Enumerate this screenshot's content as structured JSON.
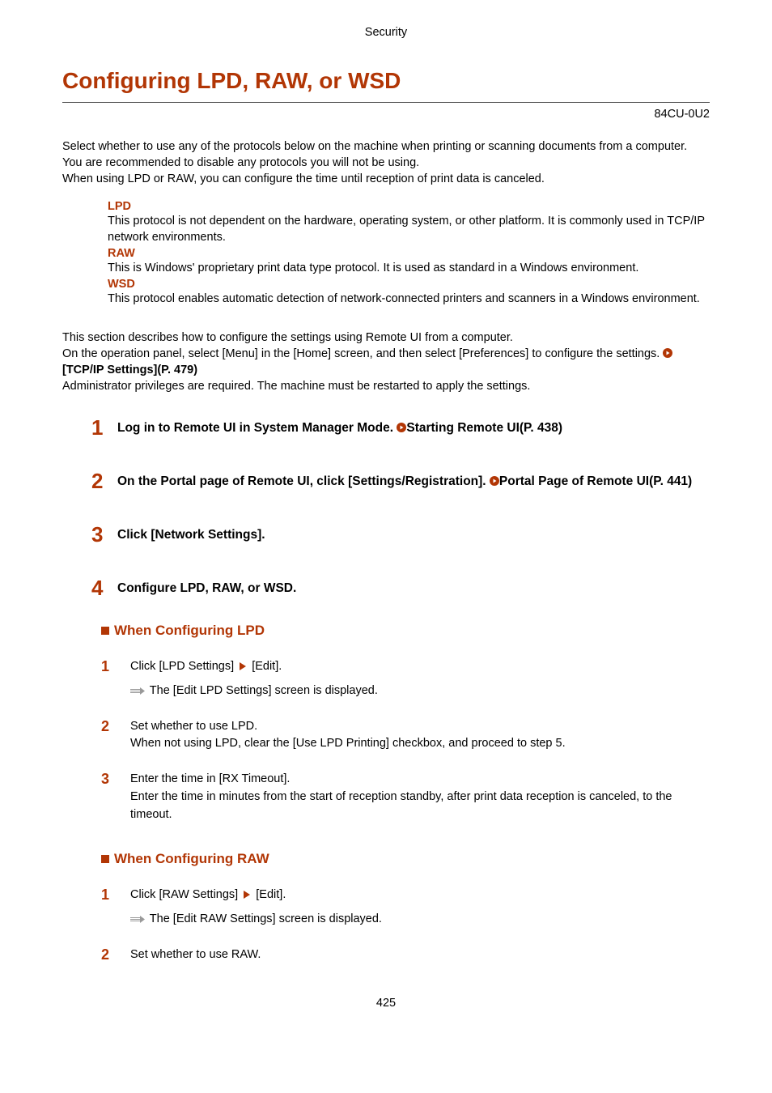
{
  "header": {
    "section": "Security"
  },
  "title": "Configuring LPD, RAW, or WSD",
  "rev_code": "84CU-0U2",
  "intro": {
    "p1": "Select whether to use any of the protocols below on the machine when printing or scanning documents from a computer.",
    "p2": "You are recommended to disable any protocols you will not be using.",
    "p3": "When using LPD or RAW, you can configure the time until reception of print data is canceled."
  },
  "protocols": {
    "lpd": {
      "name": "LPD",
      "desc": "This protocol is not dependent on the hardware, operating system, or other platform. It is commonly used in TCP/IP network environments."
    },
    "raw": {
      "name": "RAW",
      "desc": "This is Windows' proprietary print data type protocol. It is used as standard in a Windows environment."
    },
    "wsd": {
      "name": "WSD",
      "desc": "This protocol enables automatic detection of network-connected printers and scanners in a Windows environment."
    }
  },
  "section": {
    "p1": "This section describes how to configure the settings using Remote UI from a computer.",
    "p2a": "On the operation panel, select [Menu] in the [Home] screen, and then select [Preferences] to configure the settings. ",
    "link1": "[TCP/IP Settings](P. 479)",
    "p3": "Administrator privileges are required. The machine must be restarted to apply the settings."
  },
  "steps": {
    "s1": {
      "num": "1",
      "text_a": "Log in to Remote UI in System Manager Mode. ",
      "link": "Starting Remote UI(P. 438)"
    },
    "s2": {
      "num": "2",
      "text_a": "On the Portal page of Remote UI, click [Settings/Registration]. ",
      "link": "Portal Page of Remote UI(P. 441)"
    },
    "s3": {
      "num": "3",
      "text": "Click [Network Settings]."
    },
    "s4": {
      "num": "4",
      "text": "Configure LPD, RAW, or WSD."
    }
  },
  "lpd_section": {
    "title": "When Configuring LPD",
    "s1": {
      "num": "1",
      "line1a": "Click [LPD Settings] ",
      "line1b": " [Edit].",
      "result": "The [Edit LPD Settings] screen is displayed."
    },
    "s2": {
      "num": "2",
      "line1": "Set whether to use LPD.",
      "line2": "When not using LPD, clear the [Use LPD Printing] checkbox, and proceed to step 5."
    },
    "s3": {
      "num": "3",
      "line1": "Enter the time in [RX Timeout].",
      "line2": "Enter the time in minutes from the start of reception standby, after print data reception is canceled, to the timeout."
    }
  },
  "raw_section": {
    "title": "When Configuring RAW",
    "s1": {
      "num": "1",
      "line1a": "Click [RAW Settings] ",
      "line1b": " [Edit].",
      "result": "The [Edit RAW Settings] screen is displayed."
    },
    "s2": {
      "num": "2",
      "line1": "Set whether to use RAW."
    }
  },
  "page_number": "425"
}
